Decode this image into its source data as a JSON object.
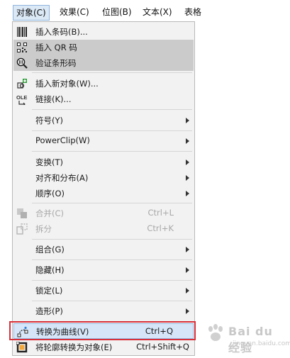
{
  "menubar": {
    "items": [
      "对象(C)",
      "效果(C)",
      "位图(B)",
      "文本(X)",
      "表格"
    ]
  },
  "menu": {
    "insert_barcode": "插入条码(B)...",
    "insert_qr": "插入 QR 码",
    "verify_barcode": "验证条形码",
    "insert_new_object": "插入新对象(W)...",
    "links": "链接(K)...",
    "symbol": "符号(Y)",
    "powerclip": "PowerClip(W)",
    "transform": "变换(T)",
    "align_distribute": "对齐和分布(A)",
    "order": "顺序(O)",
    "combine": "合并(C)",
    "combine_shortcut": "Ctrl+L",
    "break_apart": "拆分",
    "break_apart_shortcut": "Ctrl+K",
    "group": "组合(G)",
    "hide": "隐藏(H)",
    "lock": "锁定(L)",
    "shaping": "造形(P)",
    "convert_to_curves": "转换为曲线(V)",
    "convert_to_curves_shortcut": "Ctrl+Q",
    "convert_outline": "将轮廓转换为对象(E)",
    "convert_outline_shortcut": "Ctrl+Shift+Q"
  },
  "watermark": {
    "brand": "Bai du 经验",
    "url": "jingyan.baidu.com"
  },
  "colors": {
    "highlight_gray": "#cbcbcb",
    "selection_blue": "#d6e6f8",
    "annotation_red": "#d9303a"
  }
}
